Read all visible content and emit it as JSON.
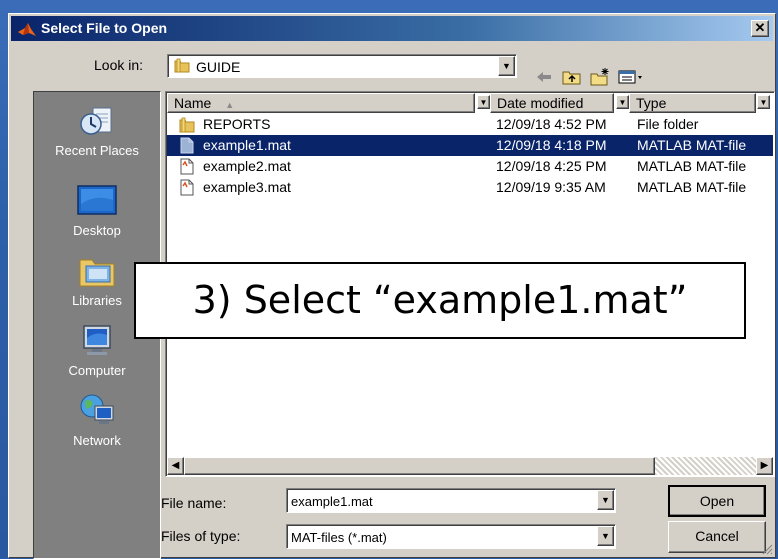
{
  "dialog": {
    "title": "Select File to Open",
    "close_label": "✕"
  },
  "look_in": {
    "label": "Look in:",
    "value": "GUIDE"
  },
  "places": [
    {
      "label": "Recent Places",
      "icon": "recent-places-icon"
    },
    {
      "label": "Desktop",
      "icon": "desktop-icon"
    },
    {
      "label": "Libraries",
      "icon": "libraries-icon"
    },
    {
      "label": "Computer",
      "icon": "computer-icon"
    },
    {
      "label": "Network",
      "icon": "network-icon"
    }
  ],
  "columns": {
    "name": "Name",
    "date": "Date modified",
    "type": "Type"
  },
  "files": [
    {
      "name": "REPORTS",
      "date": "12/09/18 4:52 PM",
      "type": "File folder",
      "icon": "folder-icon",
      "selected": false
    },
    {
      "name": "example1.mat",
      "date": "12/09/18 4:18 PM",
      "type": "MATLAB MAT-file",
      "icon": "mat-file-icon",
      "selected": true
    },
    {
      "name": "example2.mat",
      "date": "12/09/18 4:25 PM",
      "type": "MATLAB MAT-file",
      "icon": "mat-file-icon",
      "selected": false
    },
    {
      "name": "example3.mat",
      "date": "12/09/19 9:35 AM",
      "type": "MATLAB MAT-file",
      "icon": "mat-file-icon",
      "selected": false
    }
  ],
  "file_name": {
    "label": "File name:",
    "value": "example1.mat"
  },
  "file_type": {
    "label": "Files of type:",
    "value": "MAT-files (*.mat)"
  },
  "buttons": {
    "open": "Open",
    "cancel": "Cancel"
  },
  "callout": {
    "text": "3) Select “example1.mat”"
  },
  "colors": {
    "selection": "#0a246a",
    "dialog_face": "#d4d0c8",
    "places_bar": "#808080",
    "slide_background": "#2d5fa8"
  }
}
